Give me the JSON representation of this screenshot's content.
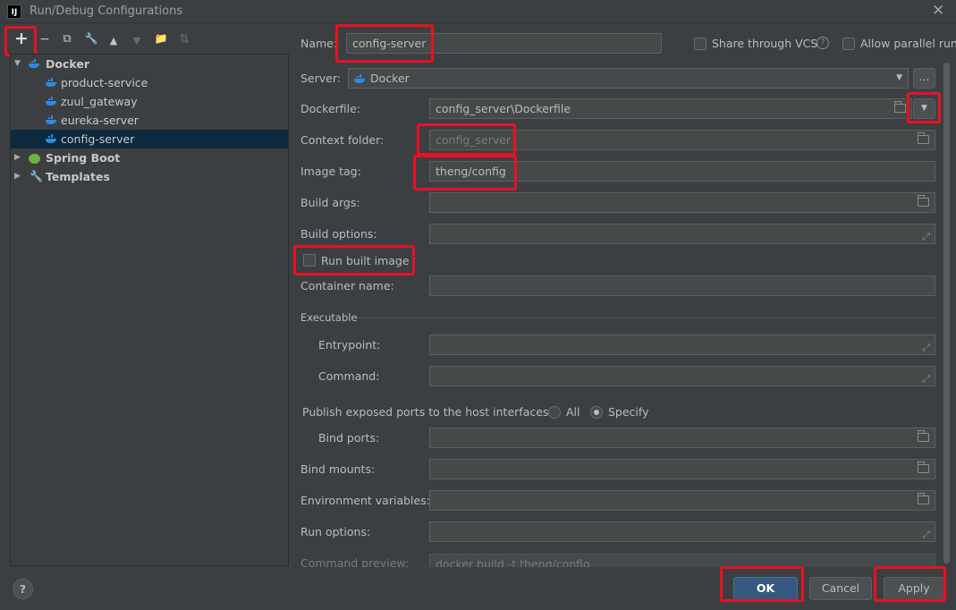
{
  "window": {
    "app_icon_text": "IJ",
    "title": "Run/Debug Configurations",
    "close_glyph": "✕"
  },
  "toolbar": {
    "add": "+",
    "remove": "−",
    "copy": "⧉",
    "edit_defaults": "🔧",
    "move_up": "▲",
    "move_down": "▼",
    "new_folder": "📁",
    "sort": "⇅"
  },
  "tree": {
    "docker_label": "Docker",
    "children": [
      "product-service",
      "zuul_gateway",
      "eureka-server",
      "config-server"
    ],
    "spring_boot_label": "Spring Boot",
    "templates_label": "Templates"
  },
  "form": {
    "name_label": "Name:",
    "name_value": "config-server",
    "share_vcs_label": "Share through VCS",
    "allow_parallel_label": "Allow parallel run",
    "server_label": "Server:",
    "server_value": "Docker",
    "server_more": "...",
    "dockerfile_label": "Dockerfile:",
    "dockerfile_value": "config_server\\Dockerfile",
    "context_folder_label": "Context folder:",
    "context_folder_value": "config_server",
    "image_tag_label": "Image tag:",
    "image_tag_value": "theng/config",
    "build_args_label": "Build args:",
    "build_options_label": "Build options:",
    "run_built_image_label": "Run built image",
    "container_name_label": "Container name:",
    "executable_label": "Executable",
    "entrypoint_label": "Entrypoint:",
    "command_label": "Command:",
    "publish_ports_label": "Publish exposed ports to the host interfaces:",
    "radio_all_label": "All",
    "radio_specify_label": "Specify",
    "bind_ports_label": "Bind ports:",
    "bind_mounts_label": "Bind mounts:",
    "env_vars_label": "Environment variables:",
    "run_options_label": "Run options:",
    "command_preview_label": "Command preview:",
    "command_preview_value": "docker build -t theng/config"
  },
  "buttons": {
    "help": "?",
    "ok": "OK",
    "cancel": "Cancel",
    "apply": "Apply"
  },
  "colors": {
    "background": "#3c3f41",
    "highlight_red": "#e81123",
    "selection": "#0d293e",
    "primary_button": "#365880"
  }
}
